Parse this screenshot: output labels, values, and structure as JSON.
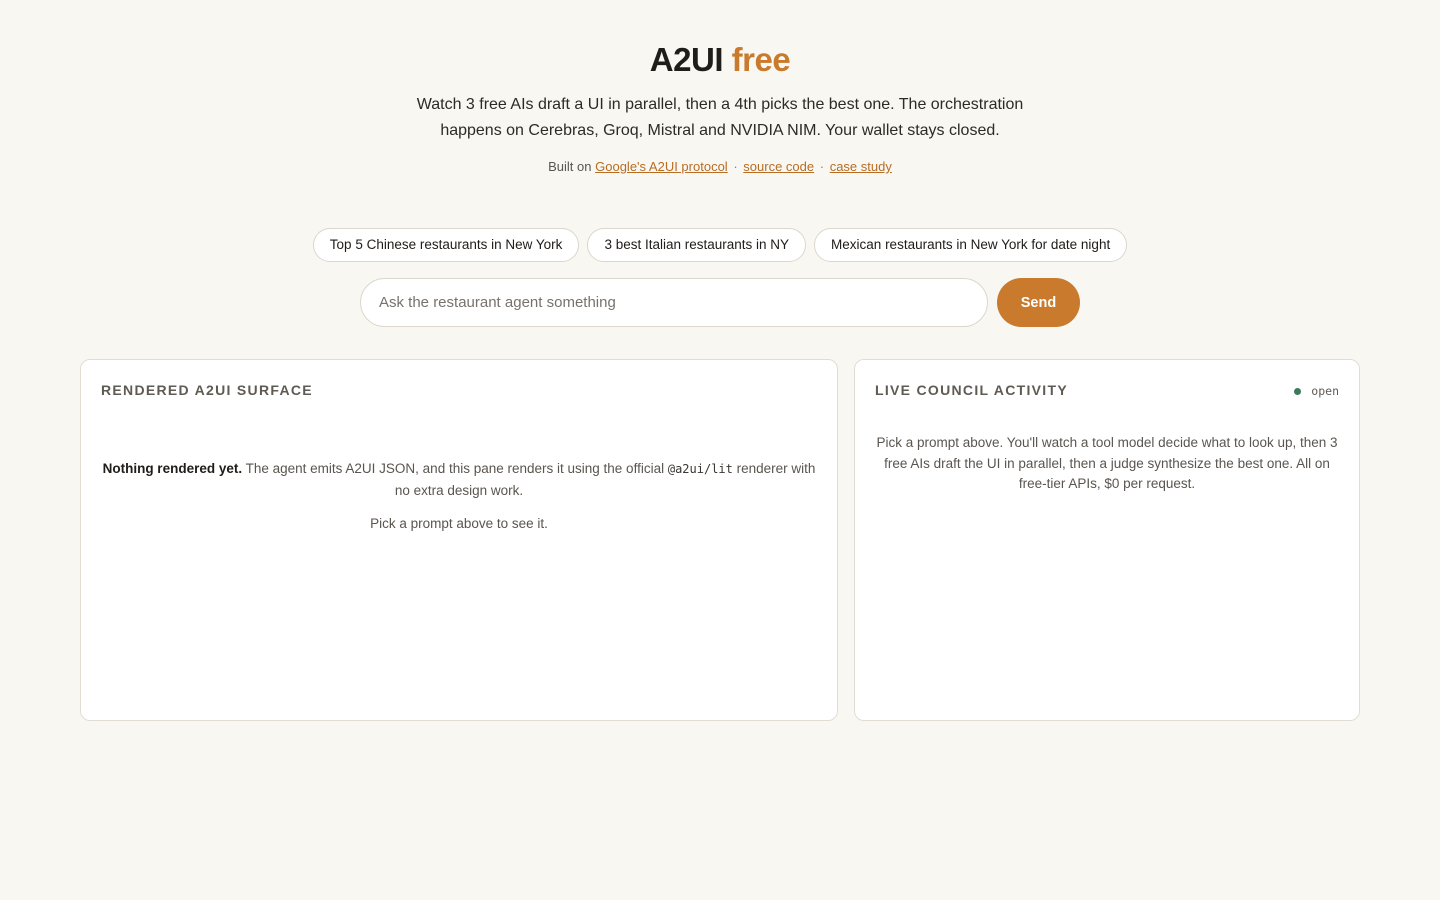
{
  "header": {
    "title_main": "A2UI",
    "title_accent": "free",
    "tagline": "Watch 3 free AIs draft a UI in parallel, then a 4th picks the best one. The orchestration happens on Cerebras, Groq, Mistral and NVIDIA NIM. Your wallet stays closed.",
    "built_prefix": "Built on",
    "links": [
      {
        "label": "Google's A2UI protocol"
      },
      {
        "label": "source code"
      },
      {
        "label": "case study"
      }
    ],
    "separator": "·"
  },
  "prompts": [
    "Top 5 Chinese restaurants in New York",
    "3 best Italian restaurants in NY",
    "Mexican restaurants in New York for date night"
  ],
  "search": {
    "placeholder": "Ask the restaurant agent something",
    "value": "",
    "send_label": "Send"
  },
  "surface_panel": {
    "title": "RENDERED A2UI SURFACE",
    "empty_strong": "Nothing rendered yet.",
    "empty_text_before": " The agent emits A2UI JSON, and this pane renders it using the official ",
    "empty_code": "@a2ui/lit",
    "empty_text_after": " renderer with no extra design work.",
    "hint": "Pick a prompt above to see it."
  },
  "council_panel": {
    "title": "LIVE COUNCIL ACTIVITY",
    "status": "open",
    "status_color": "#3d7a5a",
    "message": "Pick a prompt above. You'll watch a tool model decide what to look up, then 3 free AIs draft the UI in parallel, then a judge synthesize the best one. All on free-tier APIs, $0 per request."
  },
  "colors": {
    "accent": "#c97a2c",
    "background": "#f9f7f2"
  }
}
